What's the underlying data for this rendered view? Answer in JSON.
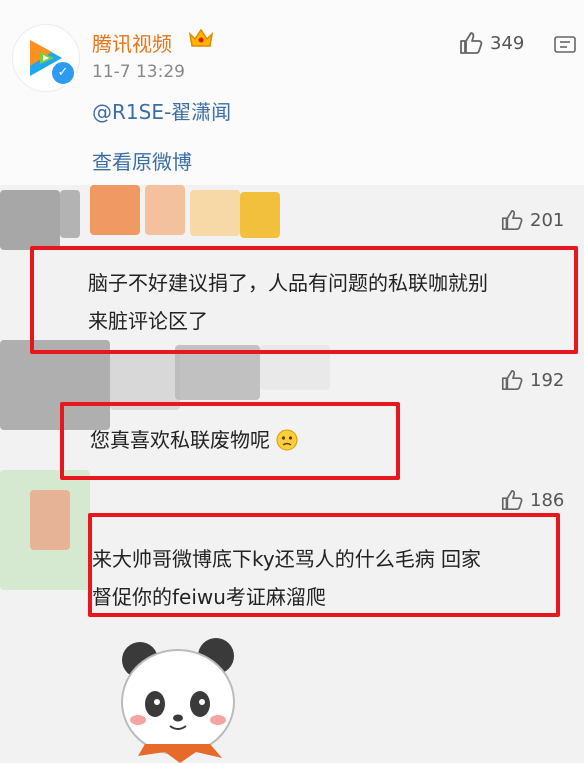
{
  "post": {
    "username": "腾讯视频",
    "time": "11-7 13:29",
    "content": "@R1SE-翟潇闻",
    "view_original": "查看原微博",
    "like_count": "349"
  },
  "comments": [
    {
      "likes": "201",
      "text_line1": "脑子不好建议捐了，人品有问题的私联咖就别",
      "text_line2": "来脏评论区了"
    },
    {
      "likes": "192",
      "text_line1": "您真喜欢私联废物呢"
    },
    {
      "likes": "186",
      "text_line1": "来大帅哥微博底下ky还骂人的什么毛病 回家",
      "text_line2": "督促你的feiwu考证麻溜爬"
    }
  ],
  "icons": [
    "tencent-video-logo",
    "verified-icon",
    "crown-icon",
    "thumb-up-icon",
    "more-icon",
    "crying-emoji",
    "panda-sticker"
  ],
  "colors": {
    "username": "#e87518",
    "link": "#3b6ea5",
    "highlight_box": "#e8161d",
    "verified": "#2f9bef"
  }
}
